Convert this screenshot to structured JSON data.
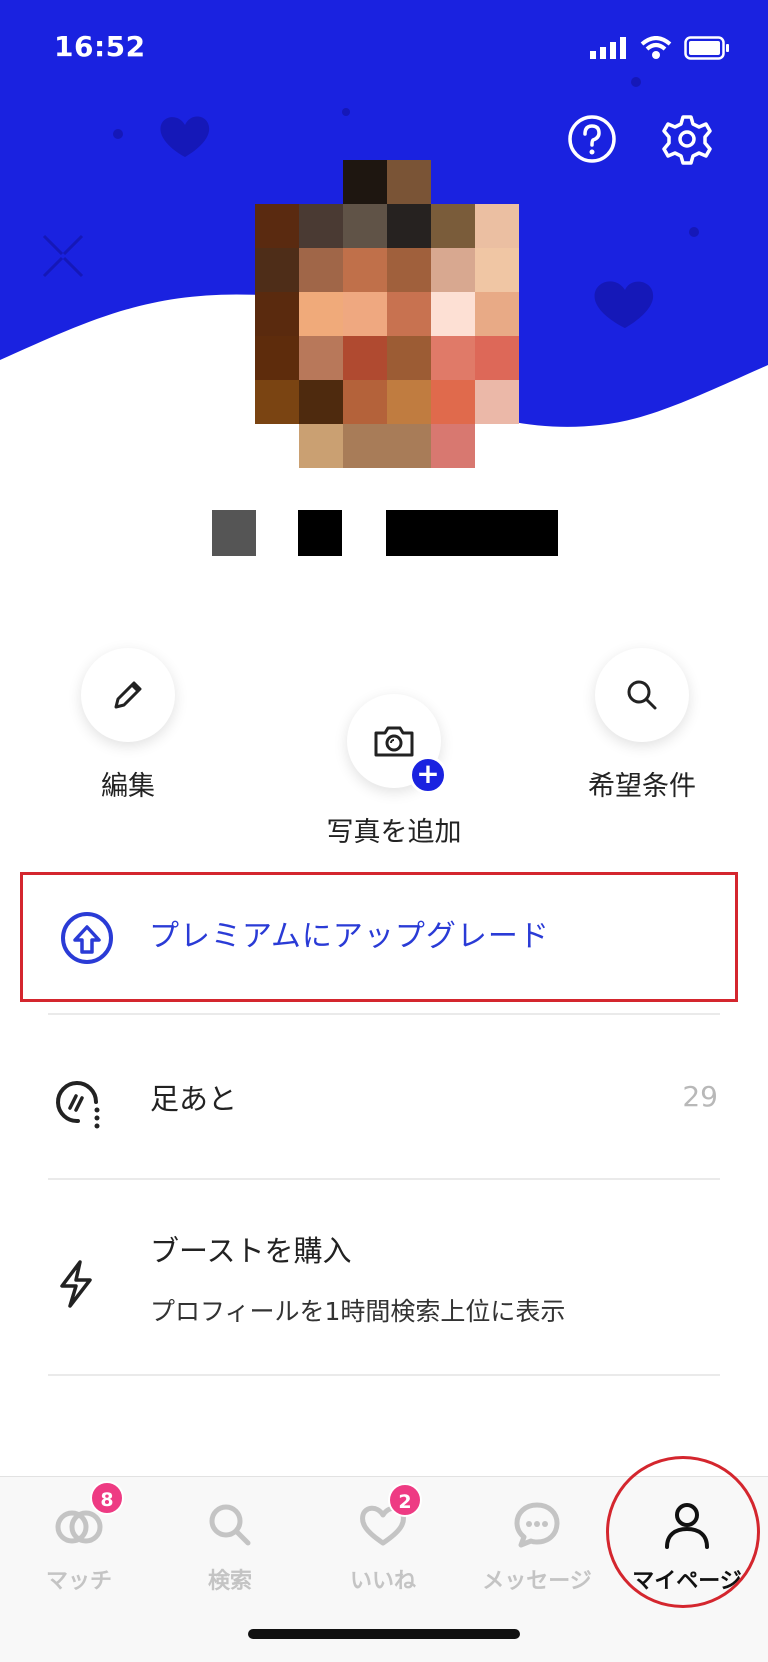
{
  "status_bar": {
    "time": "16:52"
  },
  "colors": {
    "brand_blue": "#1a22e0",
    "upgrade_text": "#2a3bd6",
    "highlight_red": "#d4262e",
    "badge_pink": "#ee3b83"
  },
  "header": {
    "icons": [
      "help-icon",
      "settings-icon"
    ]
  },
  "actions": {
    "edit": {
      "label": "編集",
      "icon": "pencil-icon"
    },
    "add_photo": {
      "label": "写真を追加",
      "icon": "camera-icon",
      "badge": "+"
    },
    "preferences": {
      "label": "希望条件",
      "icon": "search-icon"
    }
  },
  "menu": {
    "upgrade": {
      "label": "プレミアムにアップグレード",
      "icon": "upgrade-arrow-icon"
    },
    "footprints": {
      "label": "足あと",
      "count": "29",
      "icon": "footprint-icon"
    },
    "boost": {
      "label": "ブーストを購入",
      "sub": "プロフィールを1時間検索上位に表示",
      "icon": "lightning-icon"
    }
  },
  "bottom_nav": {
    "match": {
      "label": "マッチ",
      "badge": "8"
    },
    "search": {
      "label": "検索"
    },
    "likes": {
      "label": "いいね",
      "badge": "2"
    },
    "messages": {
      "label": "メッセージ"
    },
    "mypage": {
      "label": "マイページ"
    }
  }
}
